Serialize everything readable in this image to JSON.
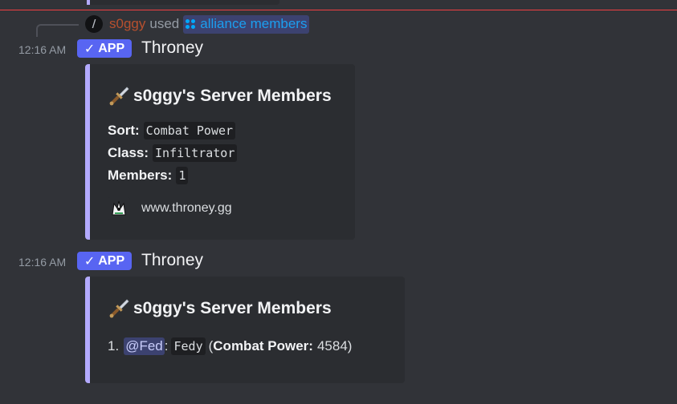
{
  "command": {
    "slash_glyph": "/",
    "user": "s0ggy",
    "used_text": "used",
    "command_name": "alliance members",
    "icon": "app-command-icon"
  },
  "messages": [
    {
      "time": "12:16 AM",
      "badge": "APP",
      "badge_check": "✓",
      "author": "Throney",
      "embed": {
        "title": "s0ggy's Server Members",
        "title_icon": "dagger-icon",
        "fields": [
          {
            "label": "Sort:",
            "value": "Combat Power"
          },
          {
            "label": "Class:",
            "value": "Infiltrator"
          },
          {
            "label": "Members:",
            "value": "1"
          }
        ],
        "footer_icon": "throney-logo-icon",
        "footer_text": "www.throney.gg"
      }
    },
    {
      "time": "12:16 AM",
      "badge": "APP",
      "badge_check": "✓",
      "author": "Throney",
      "embed": {
        "title": "s0ggy's Server Members",
        "title_icon": "dagger-icon",
        "list": [
          {
            "index": "1.",
            "mention": "@Fed",
            "separator": ":",
            "username": "Fedy",
            "open_paren": "(",
            "stat_label": "Combat Power:",
            "stat_value": "4584",
            "close_paren": ")"
          }
        ]
      }
    }
  ],
  "colors": {
    "background": "#313338",
    "embed_background": "#2b2d31",
    "embed_accent": "#b3aafe",
    "app_badge": "#5865f2",
    "new_messages_line": "#f23f42",
    "command_user": "#b8502e",
    "command_link": "#1b9ff0"
  }
}
